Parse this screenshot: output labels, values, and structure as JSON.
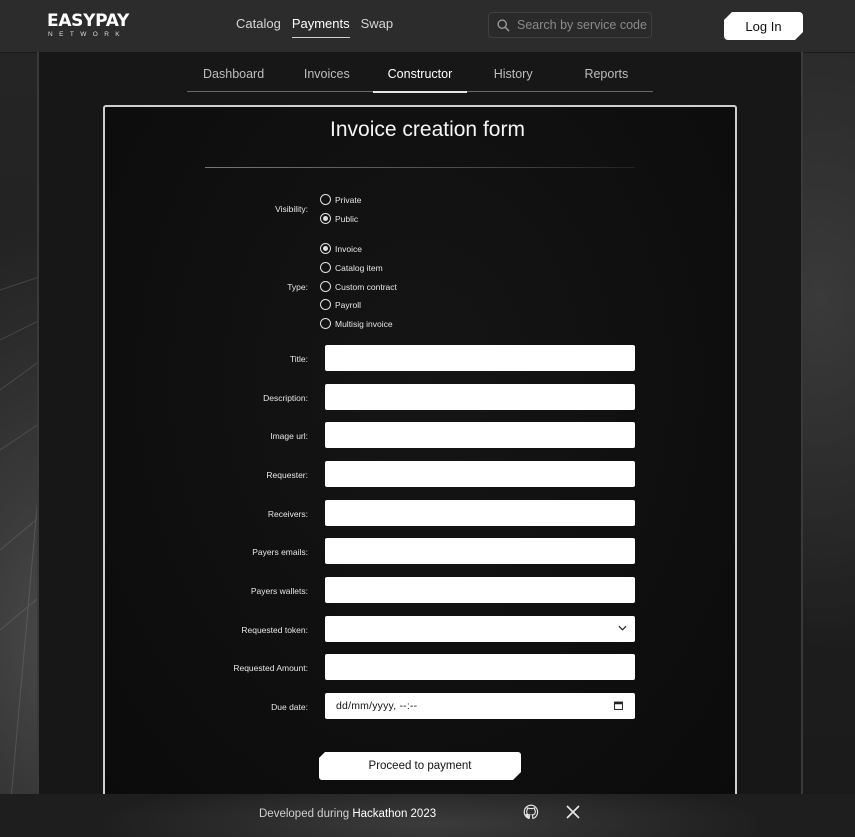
{
  "brand": {
    "name": "EASYPAY",
    "tagline": "NETWORK"
  },
  "top_nav": {
    "items": [
      "Catalog",
      "Payments",
      "Swap"
    ],
    "active": "Payments"
  },
  "search": {
    "placeholder": "Search by service code #"
  },
  "login_label": "Log In",
  "tabs": {
    "items": [
      "Dashboard",
      "Invoices",
      "Constructor",
      "History",
      "Reports"
    ],
    "active": "Constructor"
  },
  "form": {
    "title": "Invoice creation form",
    "visibility": {
      "label": "Visibility:",
      "options": [
        "Private",
        "Public"
      ],
      "selected": "Public"
    },
    "type": {
      "label": "Type:",
      "options": [
        "Invoice",
        "Catalog item",
        "Custom contract",
        "Payroll",
        "Multisig invoice"
      ],
      "selected": "Invoice"
    },
    "fields": {
      "title": "Title:",
      "description": "Description:",
      "image_url": "Image url:",
      "requester": "Requester:",
      "receivers": "Receivers:",
      "payers_emails": "Payers emails:",
      "payers_wallets": "Payers wallets:",
      "requested_token": "Requested token:",
      "requested_amount": "Requested Amount:",
      "due_date": "Due date:"
    },
    "due_date_placeholder": "dd/mm/yyyy, --:--",
    "submit_label": "Proceed to payment"
  },
  "footer": {
    "text": "Developed during",
    "highlight": "Hackathon 2023"
  },
  "colors": {
    "background": "#1a1a1a",
    "header": "#2c2c2c",
    "card_border": "#cfcfcf",
    "field": "#ffffff"
  },
  "icons": [
    "search-icon",
    "chevron-down-icon",
    "calendar-icon",
    "github-icon",
    "x-icon"
  ]
}
